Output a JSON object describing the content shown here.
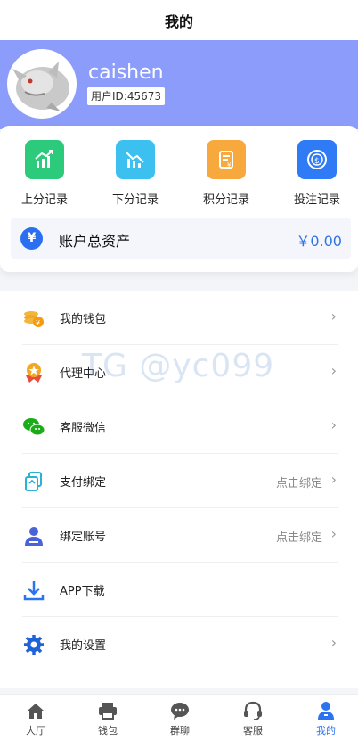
{
  "header": {
    "title": "我的"
  },
  "profile": {
    "username": "caishen",
    "user_id": "用户ID:45673"
  },
  "quick_actions": [
    {
      "label": "上分记录",
      "icon": "chart-up-icon",
      "color": "#2ccb7b"
    },
    {
      "label": "下分记录",
      "icon": "chart-down-icon",
      "color": "#3cc0f0"
    },
    {
      "label": "积分记录",
      "icon": "points-doc-icon",
      "color": "#f8a93d"
    },
    {
      "label": "投注记录",
      "icon": "bet-coin-icon",
      "color": "#2f7af5"
    }
  ],
  "assets": {
    "title": "账户总资产",
    "value": "￥0.00",
    "icon": "yen-icon"
  },
  "menu": [
    {
      "label": "我的钱包",
      "right": "",
      "icon": "coins-icon"
    },
    {
      "label": "代理中心",
      "right": "",
      "icon": "medal-icon"
    },
    {
      "label": "客服微信",
      "right": "",
      "icon": "wechat-icon"
    },
    {
      "label": "支付绑定",
      "right": "点击绑定",
      "icon": "bind-copy-icon"
    },
    {
      "label": "绑定账号",
      "right": "点击绑定",
      "icon": "user-link-icon"
    },
    {
      "label": "APP下载",
      "right": "",
      "icon": "download-icon"
    },
    {
      "label": "我的设置",
      "right": "",
      "icon": "gear-icon"
    }
  ],
  "watermark": "TG @yc099",
  "tabs": [
    {
      "label": "大厅",
      "icon": "home-icon"
    },
    {
      "label": "钱包",
      "icon": "printer-wallet-icon"
    },
    {
      "label": "群聊",
      "icon": "chat-icon"
    },
    {
      "label": "客服",
      "icon": "headset-icon"
    },
    {
      "label": "我的",
      "icon": "user-icon",
      "active": true
    }
  ],
  "colors": {
    "accent": "#2c73f0",
    "profile_bg": "#8c9cfb",
    "asset_value": "#2e74e6"
  }
}
